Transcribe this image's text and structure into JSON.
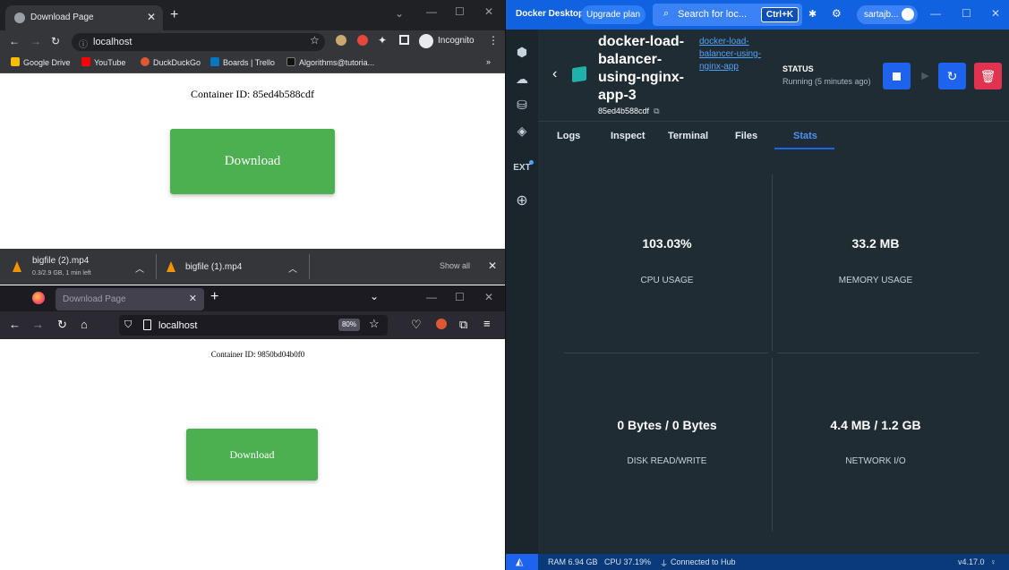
{
  "chrome": {
    "tab_title": "Download Page",
    "url": "localhost",
    "incognito_label": "Incognito",
    "bookmarks": [
      "Google Drive",
      "YouTube",
      "DuckDuckGo",
      "Boards | Trello",
      "Algorithms@tutoria..."
    ],
    "page": {
      "container_id": "Container ID: 85ed4b588cdf",
      "download_label": "Download"
    },
    "downloads": [
      {
        "name": "bigfile (2).mp4",
        "status": "0.3/2.9 GB, 1 min left"
      },
      {
        "name": "bigfile (1).mp4",
        "status": ""
      }
    ],
    "show_all": "Show all"
  },
  "firefox": {
    "tab_title": "Download Page",
    "url": "localhost",
    "zoom": "80%",
    "page": {
      "container_id": "Container ID: 9850bd04b0f0",
      "download_label": "Download"
    }
  },
  "docker": {
    "brand": "Docker Desktop",
    "upgrade_label": "Upgrade plan",
    "search_placeholder": "Search for loc...",
    "search_shortcut": "Ctrl+K",
    "username": "sartajb...",
    "container_name": "docker-load-balancer-using-nginx-app-3",
    "container_hash": "85ed4b588cdf",
    "image_link": "docker-load-balancer-using-nginx-app",
    "status_label": "STATUS",
    "status_value": "Running (5 minutes ago)",
    "ext_label": "EXT",
    "tabs": [
      "Logs",
      "Inspect",
      "Terminal",
      "Files",
      "Stats"
    ],
    "active_tab": "Stats",
    "stats": {
      "cpu": {
        "value": "103.03%",
        "label": "CPU USAGE"
      },
      "memory": {
        "value": "33.2 MB",
        "label": "MEMORY USAGE"
      },
      "disk": {
        "value": "0 Bytes / 0 Bytes",
        "label": "DISK READ/WRITE"
      },
      "network": {
        "value": "4.4 MB / 1.2 GB",
        "label": "NETWORK I/O"
      }
    },
    "footer": {
      "ram": "RAM 6.94 GB",
      "cpu": "CPU 37.19%",
      "hub": "Connected to Hub",
      "version": "v4.17.0"
    },
    "colors": {
      "topbar": "#1062e0",
      "stop": "#1d63ed",
      "delete": "#e0334f",
      "background": "#202c33"
    }
  }
}
